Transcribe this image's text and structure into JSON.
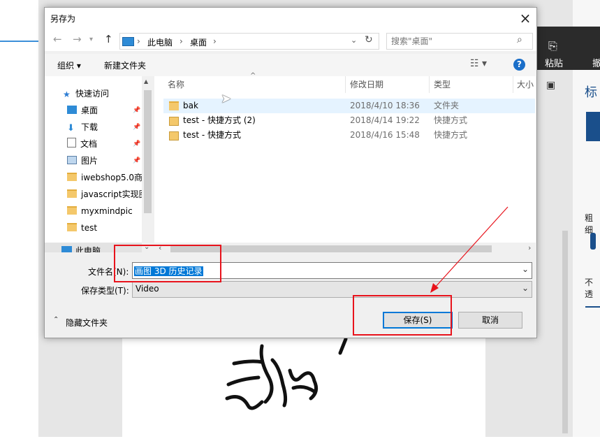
{
  "background": {
    "ribbon": {
      "paste_label": "粘贴",
      "undo_label": "撤"
    },
    "right_panel": {
      "title": "标",
      "thickness_label": "粗细",
      "opacity_label": "不透"
    }
  },
  "dialog": {
    "title": "另存为",
    "address": {
      "root": "此电脑",
      "sep": "›",
      "current": "桌面"
    },
    "search_placeholder": "搜索\"桌面\"",
    "toolbar": {
      "organize": "组织 ▾",
      "new_folder": "新建文件夹"
    },
    "sidebar": {
      "quick_access": "快速访问",
      "items": [
        {
          "label": "桌面",
          "pinned": true,
          "icon": "desktop-icon"
        },
        {
          "label": "下载",
          "pinned": true,
          "icon": "download-icon"
        },
        {
          "label": "文档",
          "pinned": true,
          "icon": "document-icon"
        },
        {
          "label": "图片",
          "pinned": true,
          "icon": "picture-icon"
        },
        {
          "label": "iwebshop5.0商",
          "pinned": false,
          "icon": "folder-icon"
        },
        {
          "label": "javascript实现图",
          "pinned": false,
          "icon": "folder-icon"
        },
        {
          "label": "myxmindpic",
          "pinned": false,
          "icon": "folder-icon"
        },
        {
          "label": "test",
          "pinned": false,
          "icon": "folder-icon"
        }
      ],
      "this_pc": "此电脑"
    },
    "columns": {
      "name": "名称",
      "date": "修改日期",
      "type": "类型",
      "size": "大小"
    },
    "files": [
      {
        "name": "bak",
        "date": "2018/4/10 18:36",
        "type": "文件夹",
        "icon": "folder-icon"
      },
      {
        "name": "test - 快捷方式 (2)",
        "date": "2018/4/14 19:22",
        "type": "快捷方式",
        "icon": "shortcut-icon"
      },
      {
        "name": "test - 快捷方式",
        "date": "2018/4/16 15:48",
        "type": "快捷方式",
        "icon": "shortcut-icon"
      }
    ],
    "filename_label": "文件名(N):",
    "filename_value": "画图 3D 历史记录",
    "filetype_label": "保存类型(T):",
    "filetype_value": "Video",
    "hide_folders": "隐藏文件夹",
    "save_button": "保存(S)",
    "cancel_button": "取消"
  },
  "colors": {
    "accent": "#0078d7",
    "annotation": "#e8131c",
    "folder": "#f4c86b"
  }
}
